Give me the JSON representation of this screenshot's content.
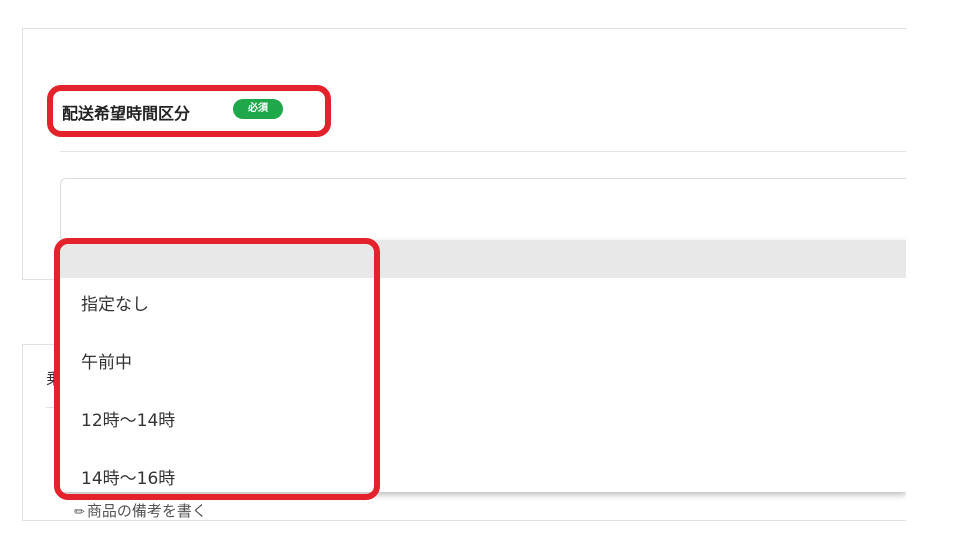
{
  "delivery_time": {
    "title": "配送希望時間区分",
    "required_badge": "必須",
    "options": [
      "指定なし",
      "午前中",
      "12時～14時",
      "14時～16時"
    ]
  },
  "next_section": {
    "partial_label": "乗"
  },
  "note_link": {
    "icon": "pencil-icon",
    "label": "商品の備考を書く"
  },
  "colors": {
    "highlight": "#e3222c",
    "required_badge": "#1fa84a"
  }
}
